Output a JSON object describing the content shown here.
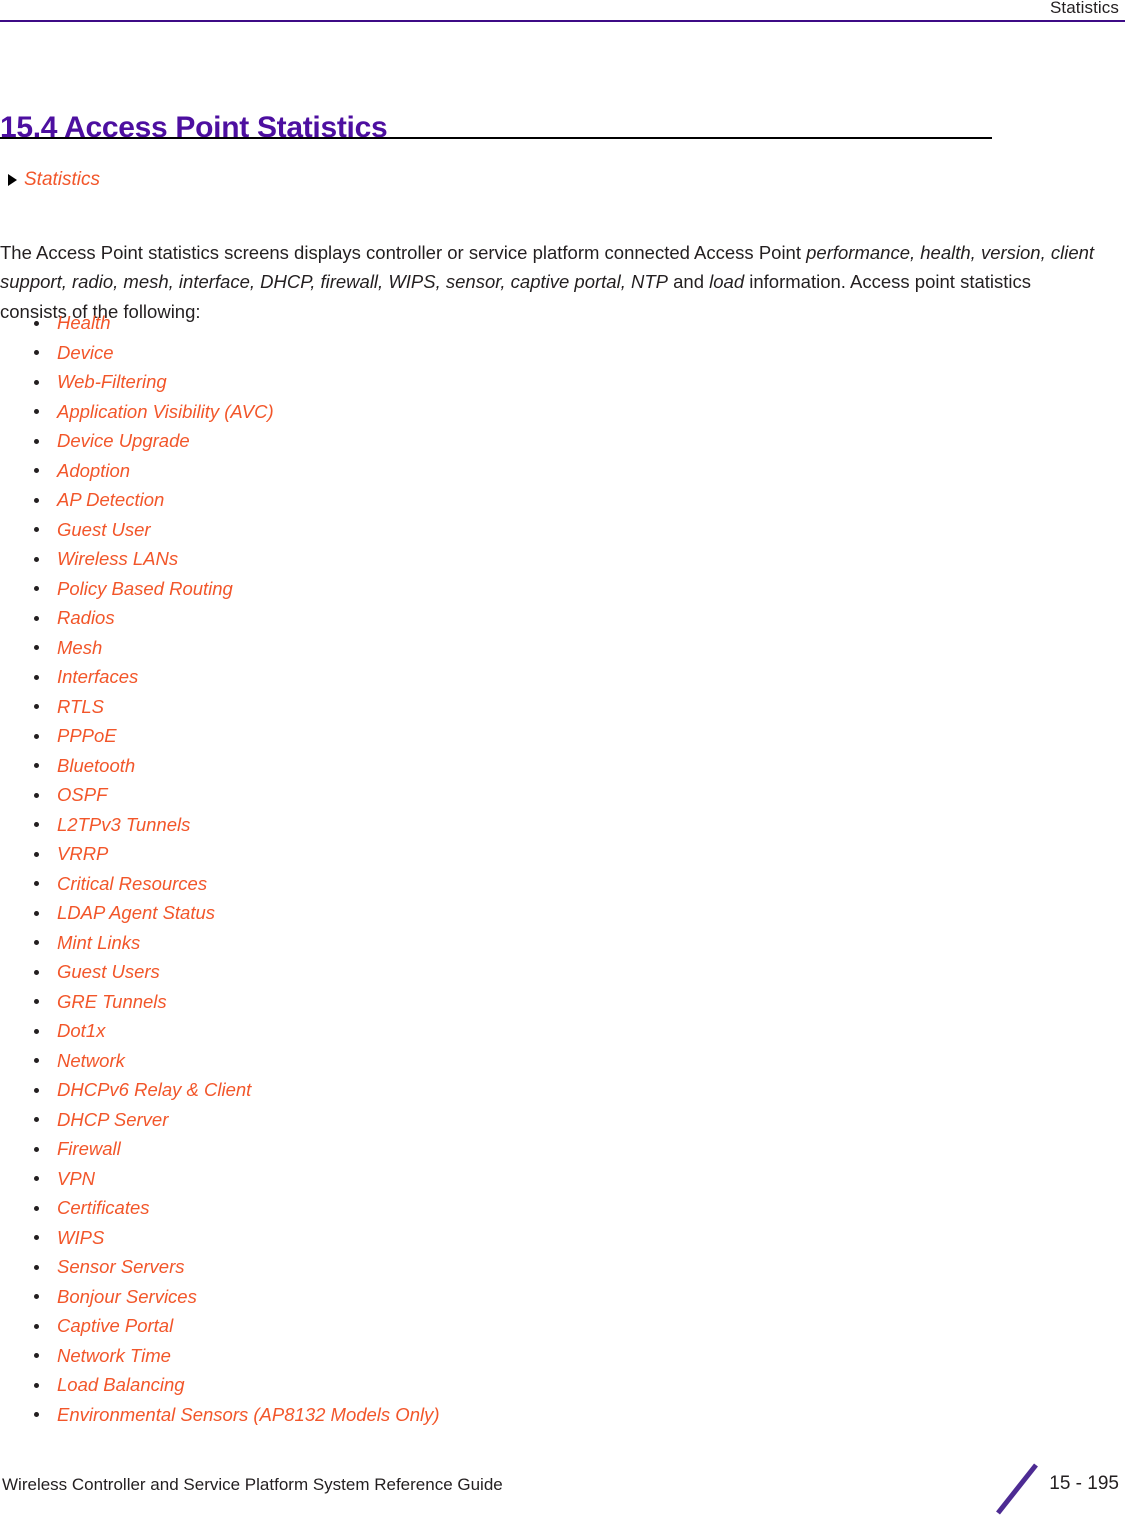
{
  "header": {
    "running_head": "Statistics",
    "rule_color": "#3d0b86"
  },
  "title": {
    "number": "15.4",
    "text": "15.4 Access Point Statistics",
    "color": "#4d0fa0"
  },
  "crumb": {
    "icon": "triangle-right-icon",
    "label": "Statistics",
    "color": "#f2562a"
  },
  "intro": {
    "part1": "The Access Point statistics screens displays controller or service platform connected Access Point ",
    "italic1": "performance, health, version, client support, radio, mesh, interface, DHCP, firewall, WIPS, sensor, captive portal, NTP",
    "part2": " and ",
    "italic2": "load",
    "part3": " information. Access point statistics consists of the following:"
  },
  "links": [
    {
      "label": "Health"
    },
    {
      "label": "Device"
    },
    {
      "label": "Web-Filtering"
    },
    {
      "label": "Application Visibility (AVC)"
    },
    {
      "label": "Device Upgrade"
    },
    {
      "label": "Adoption"
    },
    {
      "label": "AP Detection"
    },
    {
      "label": "Guest User"
    },
    {
      "label": "Wireless LANs"
    },
    {
      "label": "Policy Based Routing"
    },
    {
      "label": "Radios"
    },
    {
      "label": "Mesh"
    },
    {
      "label": "Interfaces"
    },
    {
      "label": "RTLS"
    },
    {
      "label": "PPPoE"
    },
    {
      "label": "Bluetooth"
    },
    {
      "label": "OSPF"
    },
    {
      "label": "L2TPv3 Tunnels"
    },
    {
      "label": "VRRP"
    },
    {
      "label": "Critical Resources"
    },
    {
      "label": "LDAP Agent Status"
    },
    {
      "label": "Mint Links"
    },
    {
      "label": "Guest Users"
    },
    {
      "label": "GRE Tunnels"
    },
    {
      "label": "Dot1x"
    },
    {
      "label": "Network"
    },
    {
      "label": "DHCPv6 Relay & Client"
    },
    {
      "label": "DHCP Server"
    },
    {
      "label": "Firewall"
    },
    {
      "label": "VPN"
    },
    {
      "label": "Certificates"
    },
    {
      "label": "WIPS"
    },
    {
      "label": "Sensor Servers"
    },
    {
      "label": "Bonjour Services"
    },
    {
      "label": "Captive Portal"
    },
    {
      "label": "Network Time"
    },
    {
      "label": "Load Balancing"
    },
    {
      "label": "Environmental Sensors (AP8132 Models Only)"
    }
  ],
  "footer": {
    "guide_title": "Wireless Controller and Service Platform System Reference Guide",
    "page_number": "15 - 195",
    "slash_color": "#4d2b93"
  }
}
